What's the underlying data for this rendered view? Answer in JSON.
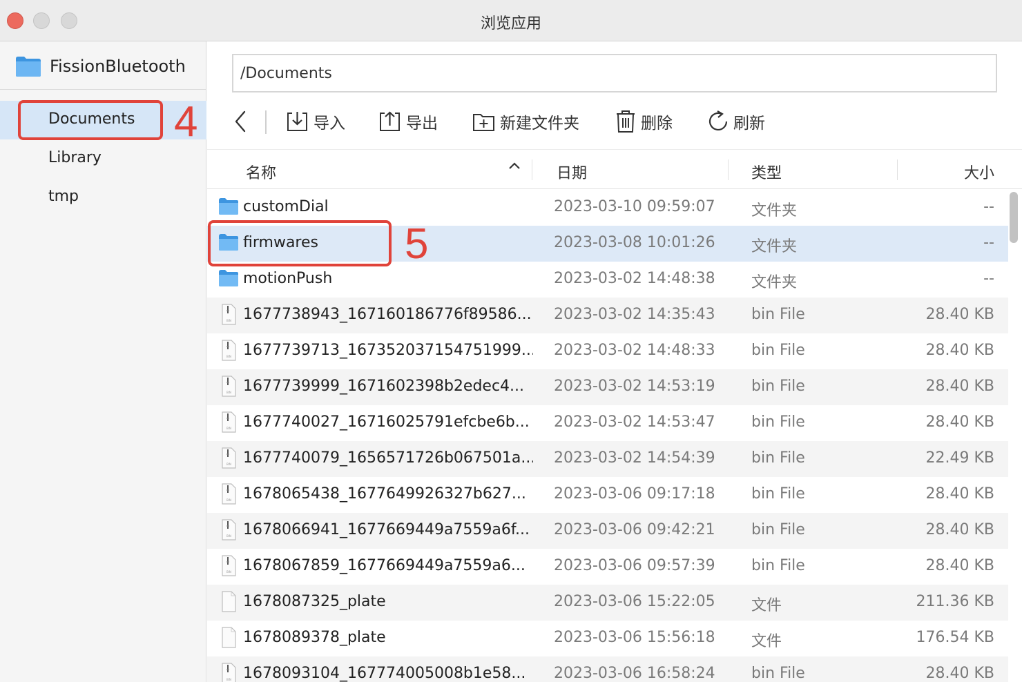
{
  "window": {
    "title": "浏览应用"
  },
  "sidebar": {
    "app_name": "FissionBluetooth",
    "items": [
      {
        "label": "Documents",
        "selected": true
      },
      {
        "label": "Library",
        "selected": false
      },
      {
        "label": "tmp",
        "selected": false
      }
    ]
  },
  "annotations": {
    "step4": "4",
    "step5": "5",
    "highlight_color": "#e0433a"
  },
  "path": {
    "value": "/Documents"
  },
  "toolbar": {
    "import_label": "导入",
    "export_label": "导出",
    "new_folder_label": "新建文件夹",
    "delete_label": "删除",
    "refresh_label": "刷新"
  },
  "table": {
    "headers": {
      "name": "名称",
      "date": "日期",
      "type": "类型",
      "size": "大小"
    },
    "rows": [
      {
        "kind": "folder",
        "name": "customDial",
        "date": "2023-03-10 09:59:07",
        "type": "文件夹",
        "size": "--"
      },
      {
        "kind": "folder",
        "name": "firmwares",
        "date": "2023-03-08 10:01:26",
        "type": "文件夹",
        "size": "--"
      },
      {
        "kind": "folder",
        "name": "motionPush",
        "date": "2023-03-02 14:48:38",
        "type": "文件夹",
        "size": "--"
      },
      {
        "kind": "bin",
        "name": "1677738943_167160186776f89586...",
        "date": "2023-03-02 14:35:43",
        "type": "bin File",
        "size": "28.40 KB"
      },
      {
        "kind": "bin",
        "name": "1677739713_167352037154751999...",
        "date": "2023-03-02 14:48:33",
        "type": "bin File",
        "size": "28.40 KB"
      },
      {
        "kind": "bin",
        "name": "1677739999_1671602398b2edec4...",
        "date": "2023-03-02 14:53:19",
        "type": "bin File",
        "size": "28.40 KB"
      },
      {
        "kind": "bin",
        "name": "1677740027_16716025791efcbe6b...",
        "date": "2023-03-02 14:53:47",
        "type": "bin File",
        "size": "28.40 KB"
      },
      {
        "kind": "bin",
        "name": "1677740079_1656571726b067501a...",
        "date": "2023-03-02 14:54:39",
        "type": "bin File",
        "size": "22.49 KB"
      },
      {
        "kind": "bin",
        "name": "1678065438_1677649926327b627...",
        "date": "2023-03-06 09:17:18",
        "type": "bin File",
        "size": "28.40 KB"
      },
      {
        "kind": "bin",
        "name": "1678066941_1677669449a7559a6f...",
        "date": "2023-03-06 09:42:21",
        "type": "bin File",
        "size": "28.40 KB"
      },
      {
        "kind": "bin",
        "name": "1678067859_1677669449a7559a6...",
        "date": "2023-03-06 09:57:39",
        "type": "bin File",
        "size": "28.40 KB"
      },
      {
        "kind": "file",
        "name": "1678087325_plate",
        "date": "2023-03-06 15:22:05",
        "type": "文件",
        "size": "211.36 KB"
      },
      {
        "kind": "file",
        "name": "1678089378_plate",
        "date": "2023-03-06 15:56:18",
        "type": "文件",
        "size": "176.54 KB"
      },
      {
        "kind": "bin",
        "name": "1678093104_167774005008b1e58...",
        "date": "2023-03-06 16:58:24",
        "type": "bin File",
        "size": "28.40 KB"
      }
    ]
  }
}
